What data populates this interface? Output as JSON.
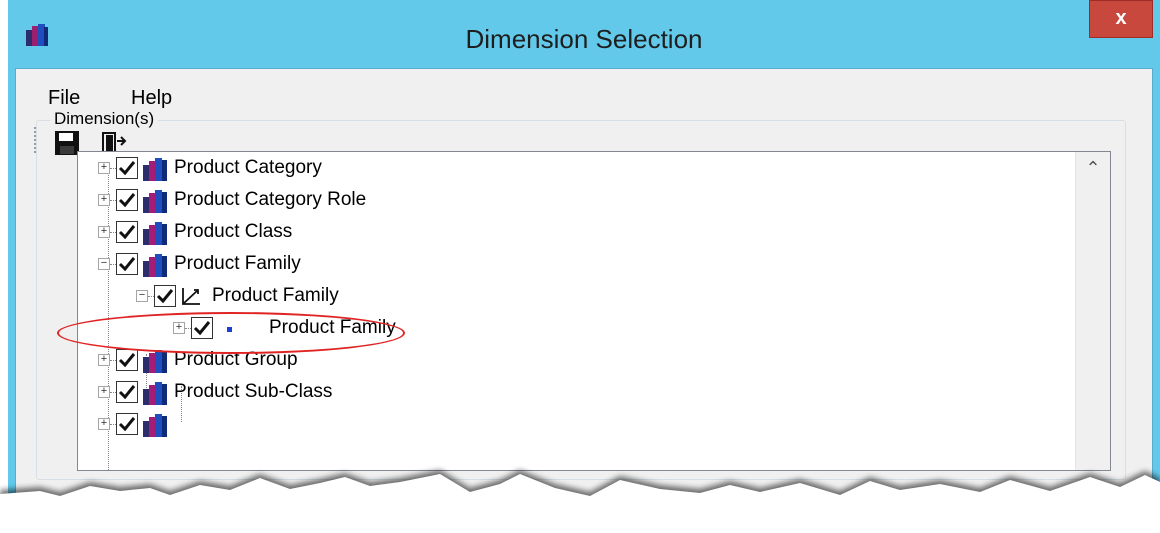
{
  "window": {
    "title": "Dimension Selection",
    "close_label": "x"
  },
  "menu": {
    "items": [
      "File",
      "Help"
    ]
  },
  "toolbar": {
    "buttons": [
      {
        "icon": "save-icon"
      },
      {
        "icon": "exit-door-icon"
      }
    ]
  },
  "group": {
    "label": "Dimension(s)"
  },
  "tree": {
    "rows": [
      {
        "label": "Product Category",
        "checked": true,
        "expanded": false,
        "icon": "cube-dimension-icon",
        "level": 0
      },
      {
        "label": "Product Category Role",
        "checked": true,
        "expanded": false,
        "icon": "cube-dimension-icon",
        "level": 0
      },
      {
        "label": "Product Class",
        "checked": true,
        "expanded": false,
        "icon": "cube-dimension-icon",
        "level": 0
      },
      {
        "label": "Product Family",
        "checked": true,
        "expanded": true,
        "icon": "cube-dimension-icon",
        "level": 0,
        "highlighted": true
      },
      {
        "label": "Product Family",
        "checked": true,
        "expanded": true,
        "icon": "hierarchy-icon",
        "level": 1
      },
      {
        "label": "Product Family",
        "checked": true,
        "expanded": false,
        "icon": "level-dot-icon",
        "level": 2
      },
      {
        "label": "Product Group",
        "checked": true,
        "expanded": false,
        "icon": "cube-dimension-icon",
        "level": 0
      },
      {
        "label": "Product Sub-Class",
        "checked": true,
        "expanded": false,
        "icon": "cube-dimension-icon",
        "level": 0
      },
      {
        "label": "",
        "checked": true,
        "expanded": false,
        "icon": "cube-dimension-icon",
        "level": 0
      }
    ]
  },
  "colors": {
    "titlebar": "#62c9ea",
    "close": "#c8483d",
    "highlight": "#e02424"
  }
}
